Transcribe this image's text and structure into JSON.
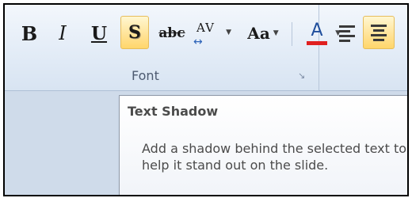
{
  "ribbon": {
    "font_group": {
      "label": "Font",
      "buttons": {
        "bold": "B",
        "italic": "I",
        "underline": "U",
        "text_shadow": "S",
        "strikethrough": "abc",
        "character_spacing": "AV",
        "change_case": "Aa",
        "font_color": "A"
      },
      "launcher_icon": "dialog-launcher-icon"
    },
    "paragraph_group": {
      "align_left_icon": "align-left-icon",
      "center_icon": "align-center-icon"
    },
    "colors": {
      "highlight": "#ffe294",
      "font_color_bar": "#e02020",
      "spacing_arrow": "#2d63b8"
    }
  },
  "tooltip": {
    "title": "Text Shadow",
    "body": "Add a shadow behind the selected text to help it stand out on the slide."
  }
}
